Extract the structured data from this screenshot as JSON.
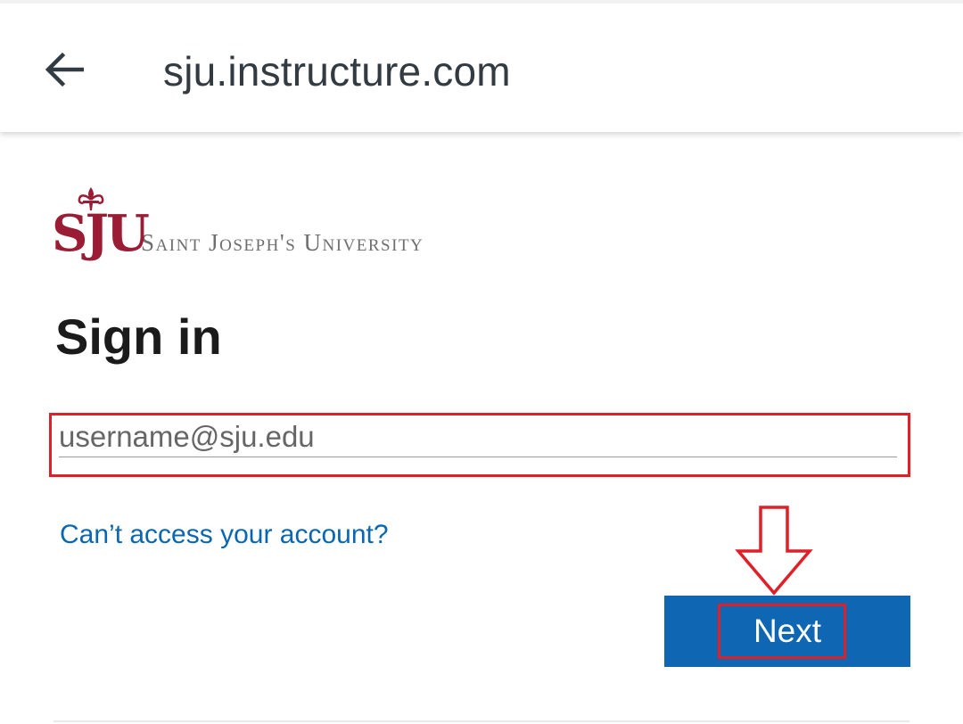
{
  "header": {
    "title": "sju.instructure.com",
    "back_icon": "arrow-left-icon"
  },
  "logo": {
    "letters": "SJU",
    "name": "Saint Joseph's University",
    "brand_color": "#9b1c35"
  },
  "signin": {
    "heading": "Sign in",
    "email_placeholder": "username@sju.edu",
    "email_value": "",
    "cant_access_link": "Can’t access your account?",
    "next_button": "Next"
  },
  "annotations": {
    "highlight_color": "#e11f26",
    "arrow_icon": "down-arrow-callout-icon"
  },
  "colors": {
    "primary_button": "#0f67b4",
    "link": "#0a66b0"
  }
}
